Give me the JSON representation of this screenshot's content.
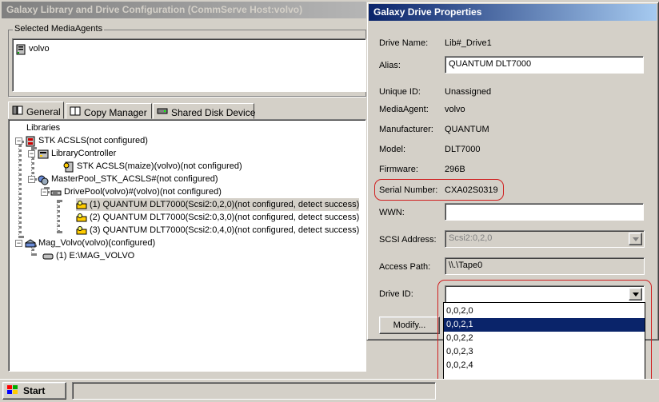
{
  "main_window": {
    "title": "Galaxy Library and Drive Configuration (CommServe Host:volvo)",
    "media_agents_group": "Selected MediaAgents",
    "media_agents": [
      "volvo"
    ],
    "tabs": [
      {
        "label": "General"
      },
      {
        "label": "Copy Manager"
      },
      {
        "label": "Shared Disk Device"
      }
    ],
    "tree": {
      "root": "Libraries",
      "stk": "STK ACSLS(not configured)",
      "library_controller": "LibraryController",
      "controller_child": "STK ACSLS(maize)(volvo)(not configured)",
      "master_pool": "MasterPool_STK_ACSLS#(not configured)",
      "drive_pool": "DrivePool(volvo)#(volvo)(not configured)",
      "drives": [
        "(1) QUANTUM DLT7000(Scsi2:0,2,0)(not configured, detect success)",
        "(2) QUANTUM DLT7000(Scsi2:0,3,0)(not configured, detect success)",
        "(3) QUANTUM DLT7000(Scsi2:0,4,0)(not configured, detect success)"
      ],
      "mag": "Mag_Volvo(volvo)(configured)",
      "mag_child": "(1) E:\\MAG_VOLVO"
    }
  },
  "dialog": {
    "title": "Galaxy Drive Properties",
    "drive_name_label": "Drive Name:",
    "drive_name": "Lib#_Drive1",
    "alias_label": "Alias:",
    "alias": "QUANTUM DLT7000",
    "unique_id_label": "Unique ID:",
    "unique_id": "Unassigned",
    "media_agent_label": "MediaAgent:",
    "media_agent": "volvo",
    "manufacturer_label": "Manufacturer:",
    "manufacturer": "QUANTUM",
    "model_label": "Model:",
    "model": "DLT7000",
    "firmware_label": "Firmware:",
    "firmware": "296B",
    "serial_label": "Serial Number:",
    "serial": "CXA02S0319",
    "wwn_label": "WWN:",
    "wwn": "",
    "scsi_label": "SCSI Address:",
    "scsi": "Scsi2:0,2,0",
    "access_path_label": "Access Path:",
    "access_path": "\\\\.\\Tape0",
    "drive_id_label": "Drive ID:",
    "drive_id": "",
    "drive_id_options": [
      "0,0,2,0",
      "0,0,2,1",
      "0,0,2,2",
      "0,0,2,3",
      "0,0,2,4"
    ],
    "drive_id_selected_index": 1,
    "modify_button": "Modify..."
  },
  "taskbar": {
    "start": "Start"
  },
  "colors": {
    "selection": "#0a246a",
    "highlight_annotation": "#d02020"
  }
}
